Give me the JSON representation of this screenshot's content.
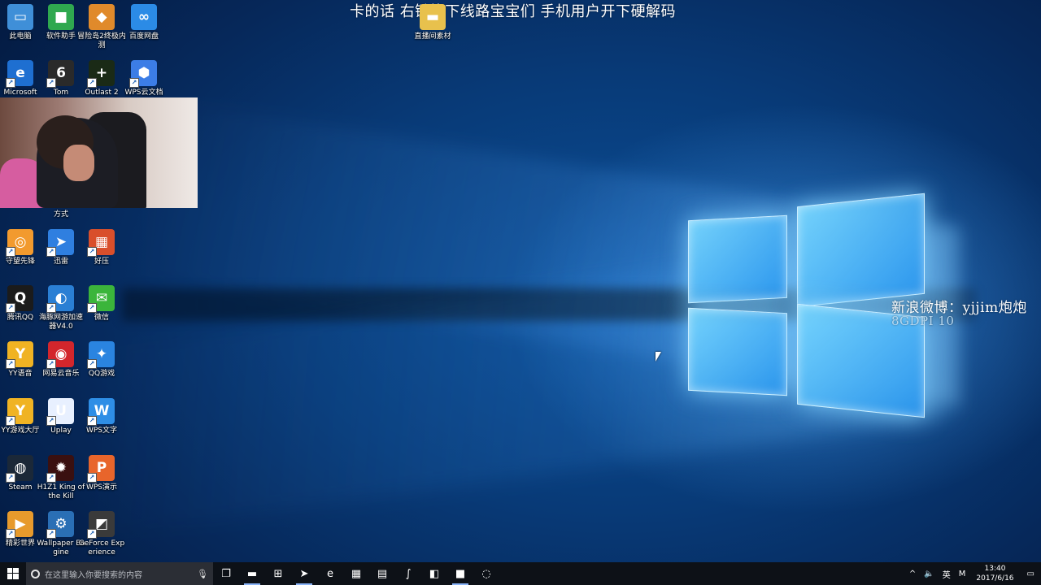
{
  "overlay": {
    "top_text": "卡的话 右键换下线路宝宝们 手机用户开下硬解码",
    "right_text_1": "新浪微博：yjjim炮炮",
    "right_text_2": "8GDPI 10"
  },
  "desktop_icons": [
    {
      "label": "此电脑",
      "icon": "computer-icon",
      "color": "#3f8fd8",
      "glyph": "▭"
    },
    {
      "label": "软件助手",
      "icon": "app-grid-icon",
      "color": "#2fa84f",
      "glyph": "■"
    },
    {
      "label": "冒险岛2终极内测",
      "icon": "game-maplestory-icon",
      "color": "#e08a2b",
      "glyph": "◆"
    },
    {
      "label": "百度网盘",
      "icon": "cloud-icon",
      "color": "#2b8be6",
      "glyph": "∞"
    },
    {
      "label": "Microsoft",
      "icon": "edge-icon",
      "color": "#1e6fd1",
      "glyph": "e"
    },
    {
      "label": "Tom",
      "icon": "game-rainbow-six-icon",
      "color": "#2a2a2a",
      "glyph": "6"
    },
    {
      "label": "Outlast 2",
      "icon": "game-outlast-icon",
      "color": "#1a2a16",
      "glyph": "+"
    },
    {
      "label": "WPS云文档",
      "icon": "wps-cloud-icon",
      "color": "#3c7de6",
      "glyph": "⬢"
    },
    {
      "label": "方式",
      "icon": "shortcut-icon",
      "color": "#666666",
      "glyph": ""
    },
    {
      "label": "守望先锋",
      "icon": "overwatch-icon",
      "color": "#f29a2e",
      "glyph": "◎"
    },
    {
      "label": "迅雷",
      "icon": "thunder-icon",
      "color": "#2f7fe0",
      "glyph": "➤"
    },
    {
      "label": "好压",
      "icon": "haozip-icon",
      "color": "#d94f2b",
      "glyph": "▦"
    },
    {
      "label": "腾讯QQ",
      "icon": "qq-icon",
      "color": "#1b1b1b",
      "glyph": "Q"
    },
    {
      "label": "海豚网游加速器V4.0",
      "icon": "dolphin-icon",
      "color": "#2a7fd4",
      "glyph": "◐"
    },
    {
      "label": "微信",
      "icon": "wechat-icon",
      "color": "#3bb53b",
      "glyph": "✉"
    },
    {
      "label": "YY语音",
      "icon": "yy-icon",
      "color": "#f0b323",
      "glyph": "Y"
    },
    {
      "label": "网易云音乐",
      "icon": "netease-music-icon",
      "color": "#d3262c",
      "glyph": "◉"
    },
    {
      "label": "QQ游戏",
      "icon": "qq-game-icon",
      "color": "#2a84e0",
      "glyph": "✦"
    },
    {
      "label": "YY游戏大厅",
      "icon": "yy-game-icon",
      "color": "#f0b323",
      "glyph": "Y"
    },
    {
      "label": "Uplay",
      "icon": "uplay-icon",
      "color": "#e8f0ff",
      "glyph": "U"
    },
    {
      "label": "WPS文字",
      "icon": "wps-writer-icon",
      "color": "#2e8ee6",
      "glyph": "W"
    },
    {
      "label": "Steam",
      "icon": "steam-icon",
      "color": "#1b2838",
      "glyph": "◍"
    },
    {
      "label": "H1Z1 King of the Kill",
      "icon": "h1z1-icon",
      "color": "#3a1010",
      "glyph": "✹"
    },
    {
      "label": "WPS演示",
      "icon": "wps-presentation-icon",
      "color": "#e8652b",
      "glyph": "P"
    },
    {
      "label": "精彩世界",
      "icon": "media-icon",
      "color": "#e79a2c",
      "glyph": "▶"
    },
    {
      "label": "Wallpaper Engine",
      "icon": "wallpaper-engine-icon",
      "color": "#2a6fb5",
      "glyph": "⚙"
    },
    {
      "label": "GeForce Experience",
      "icon": "geforce-icon",
      "color": "#3a3a3a",
      "glyph": "◩"
    },
    {
      "label": "直播间素材",
      "icon": "folder-icon",
      "color": "#e8c14d",
      "glyph": "▬"
    }
  ],
  "taskbar": {
    "search_placeholder": "在这里输入你要搜索的内容",
    "apps": [
      {
        "icon": "task-view-icon",
        "glyph": "❐",
        "active": false
      },
      {
        "icon": "file-explorer-icon",
        "glyph": "▬",
        "active": true
      },
      {
        "icon": "store-icon",
        "glyph": "⊞",
        "active": false
      },
      {
        "icon": "thunder-icon",
        "glyph": "➤",
        "active": true
      },
      {
        "icon": "edge-icon",
        "glyph": "e",
        "active": false
      },
      {
        "icon": "app-blue-icon",
        "glyph": "▦",
        "active": false
      },
      {
        "icon": "notepad-icon",
        "glyph": "▤",
        "active": false
      },
      {
        "icon": "app-line-icon",
        "glyph": "∫",
        "active": false
      },
      {
        "icon": "app-paper-icon",
        "glyph": "◧",
        "active": false
      },
      {
        "icon": "app-green-icon",
        "glyph": "■",
        "active": true
      },
      {
        "icon": "app-circle-icon",
        "glyph": "◌",
        "active": false
      }
    ],
    "tray": {
      "chevron": "^",
      "volume": "🔈",
      "ime": "英",
      "ime2": "M",
      "time": "13:40",
      "date": "2017/6/16"
    }
  },
  "colors": {
    "taskbar_bg": "#0d1117",
    "accent": "#8ab4f8"
  }
}
